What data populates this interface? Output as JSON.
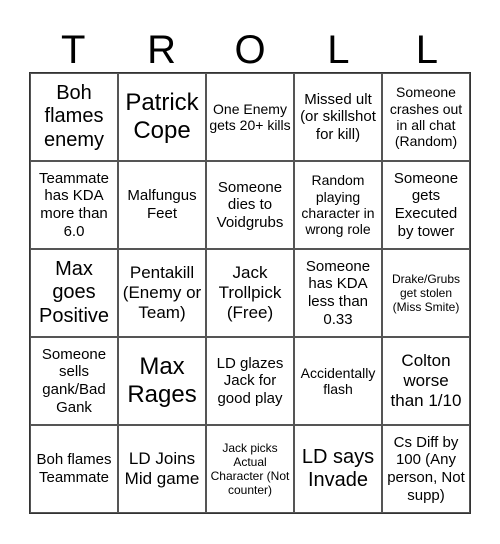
{
  "title_letters": [
    "T",
    "R",
    "O",
    "L",
    "L"
  ],
  "cells": [
    {
      "text": "Boh flames enemy",
      "size": "l"
    },
    {
      "text": "Patrick Cope",
      "size": "xl"
    },
    {
      "text": "One Enemy gets 20+ kills",
      "size": "s"
    },
    {
      "text": "Missed ult (or skillshot for kill)",
      "size": "ms"
    },
    {
      "text": "Someone crashes out in all chat (Random)",
      "size": "s"
    },
    {
      "text": "Teammate has KDA more than 6.0",
      "size": "ms"
    },
    {
      "text": "Malfungus Feet",
      "size": "ms"
    },
    {
      "text": "Someone dies to Voidgrubs",
      "size": "ms"
    },
    {
      "text": "Random playing character in wrong role",
      "size": "s"
    },
    {
      "text": "Someone gets Executed by tower",
      "size": "ms"
    },
    {
      "text": "Max goes Positive",
      "size": "l"
    },
    {
      "text": "Pentakill (Enemy or Team)",
      "size": "m"
    },
    {
      "text": "Jack Trollpick (Free)",
      "size": "m"
    },
    {
      "text": "Someone has KDA less than 0.33",
      "size": "ms"
    },
    {
      "text": "Drake/Grubs get stolen (Miss Smite)",
      "size": "xs"
    },
    {
      "text": "Someone sells gank/Bad Gank",
      "size": "ms"
    },
    {
      "text": "Max Rages",
      "size": "xl"
    },
    {
      "text": "LD glazes Jack for good play",
      "size": "ms"
    },
    {
      "text": "Accidentally flash",
      "size": "s"
    },
    {
      "text": "Colton worse than 1/10",
      "size": "m"
    },
    {
      "text": "Boh flames Teammate",
      "size": "ms"
    },
    {
      "text": "LD Joins Mid game",
      "size": "m"
    },
    {
      "text": "Jack picks Actual Character (Not counter)",
      "size": "xs"
    },
    {
      "text": "LD says Invade",
      "size": "l"
    },
    {
      "text": "Cs Diff by 100 (Any person, Not supp)",
      "size": "ms"
    }
  ]
}
